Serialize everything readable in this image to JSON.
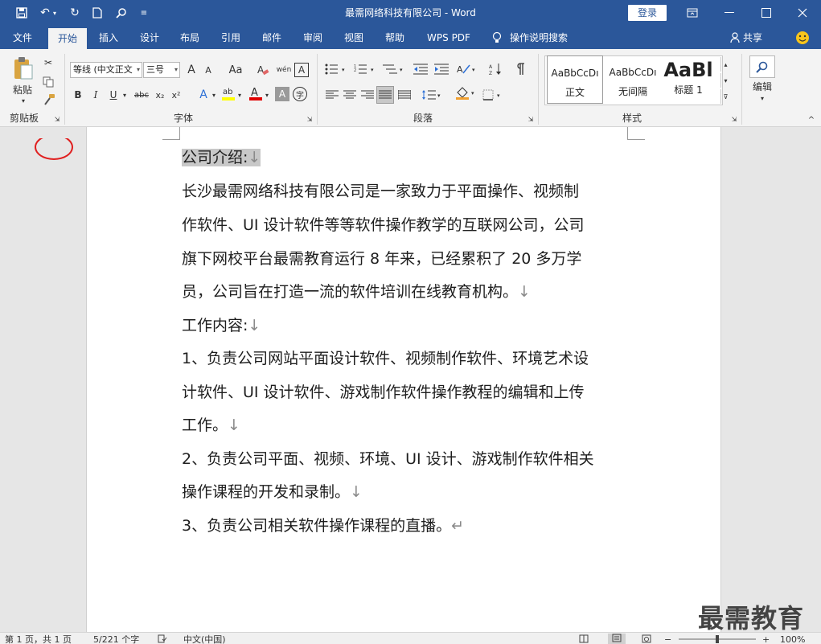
{
  "window": {
    "title": "最需网络科技有限公司 - Word",
    "login_label": "登录"
  },
  "tabs": [
    {
      "label": "文件"
    },
    {
      "label": "开始"
    },
    {
      "label": "插入"
    },
    {
      "label": "设计"
    },
    {
      "label": "布局"
    },
    {
      "label": "引用"
    },
    {
      "label": "邮件"
    },
    {
      "label": "审阅"
    },
    {
      "label": "视图"
    },
    {
      "label": "帮助"
    },
    {
      "label": "WPS PDF"
    },
    {
      "label": "操作说明搜索"
    }
  ],
  "share_label": "共享",
  "ribbon": {
    "clipboard": {
      "paste_label": "粘贴",
      "group_label": "剪贴板"
    },
    "font": {
      "font_name": "等线 (中文正文",
      "font_size": "三号",
      "group_label": "字体",
      "bold": "B",
      "italic": "I",
      "underline": "U",
      "strike": "abc",
      "subscript": "x₂",
      "superscript": "x²",
      "grow": "A",
      "shrink": "A",
      "case": "Aa",
      "pinyin": "wén",
      "border_char": "A",
      "highlight_char": "A",
      "shade_char": "A",
      "circle_char": "字"
    },
    "paragraph": {
      "group_label": "段落"
    },
    "styles": {
      "group_label": "样式",
      "items": [
        {
          "sample": "AaBbCcDı",
          "name": "正文"
        },
        {
          "sample": "AaBbCcDı",
          "name": "无间隔"
        },
        {
          "sample": "AaBl",
          "name": "标题 1"
        }
      ]
    },
    "editing": {
      "label": "编辑"
    }
  },
  "document": {
    "lines": [
      {
        "text": "公司介绍:",
        "mark": "↓"
      },
      {
        "text": "长沙最需网络科技有限公司是一家致力于平面操作、视频制",
        "mark": ""
      },
      {
        "text": "作软件、UI 设计软件等等软件操作教学的互联网公司，公司",
        "mark": ""
      },
      {
        "text": "旗下网校平台最需教育运行 8 年来，已经累积了 20 多万学",
        "mark": ""
      },
      {
        "text": "员，公司旨在打造一流的软件培训在线教育机构。",
        "mark": "↓"
      },
      {
        "text": "工作内容:",
        "mark": "↓"
      },
      {
        "text": "1、负责公司网站平面设计软件、视频制作软件、环境艺术设",
        "mark": ""
      },
      {
        "text": "计软件、UI 设计软件、游戏制作软件操作教程的编辑和上传",
        "mark": ""
      },
      {
        "text": "工作。",
        "mark": "↓"
      },
      {
        "text": "2、负责公司平面、视频、环境、UI 设计、游戏制作软件相关",
        "mark": ""
      },
      {
        "text": "操作课程的开发和录制。",
        "mark": "↓"
      },
      {
        "text": "3、负责公司相关软件操作课程的直播。",
        "mark": "↵"
      }
    ]
  },
  "status": {
    "page": "第 1 页，共 1 页",
    "words": "5/221 个字",
    "language": "中文(中国)",
    "zoom": "100%"
  },
  "watermark": "最需教育",
  "colors": {
    "brand": "#2b579a",
    "annotation": "#e02020"
  }
}
